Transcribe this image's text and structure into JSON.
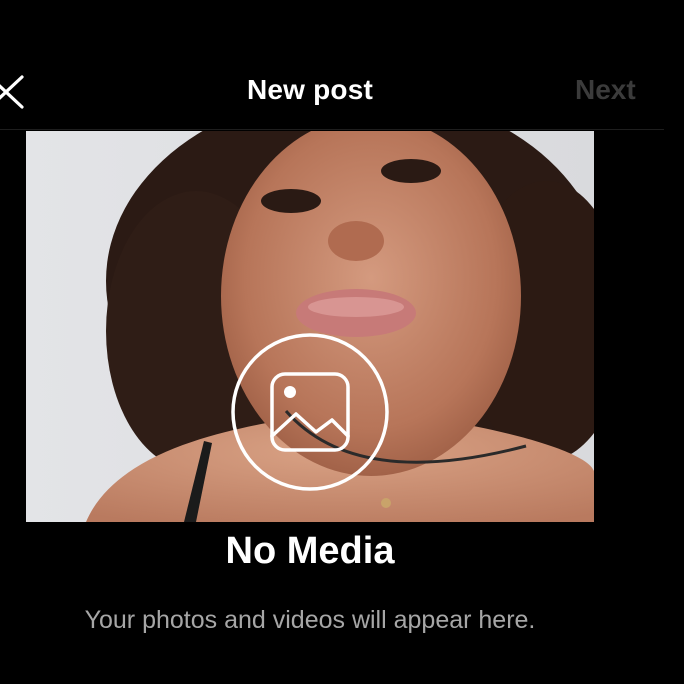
{
  "header": {
    "title": "New post",
    "next_label": "Next",
    "close_icon": "close-icon"
  },
  "empty_state": {
    "title": "No Media",
    "subtitle": "Your photos and videos will appear here.",
    "icon": "photo-icon"
  },
  "colors": {
    "background": "#000000",
    "text_primary": "#ffffff",
    "text_secondary": "#a6a6a6",
    "next_disabled": "#3b3b3b"
  }
}
